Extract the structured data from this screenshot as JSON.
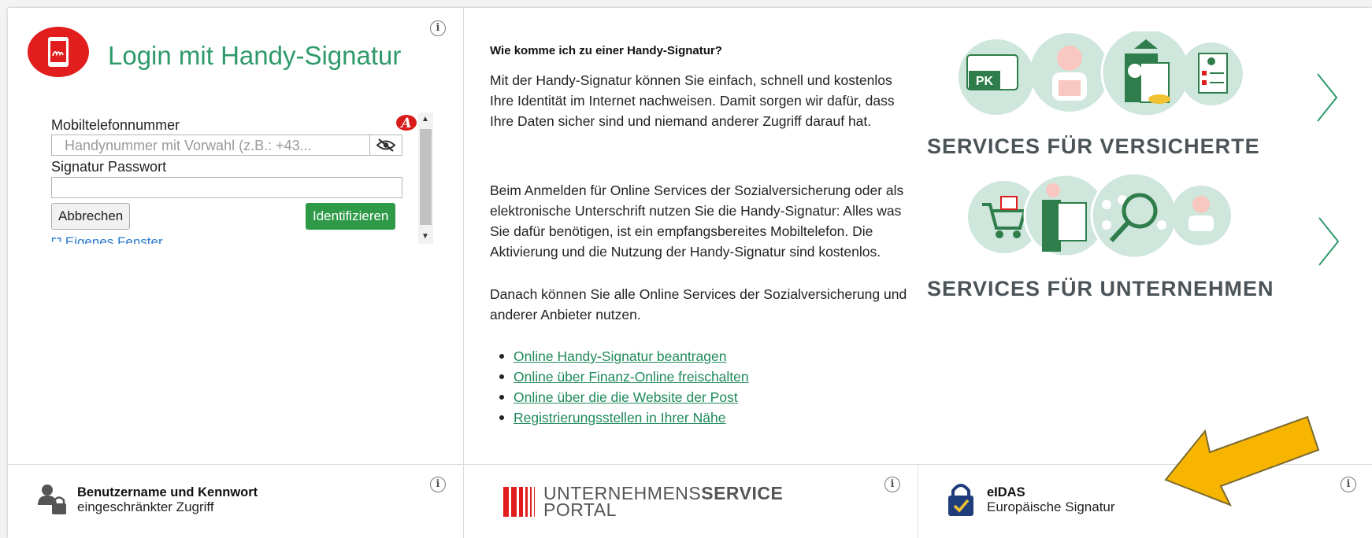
{
  "login": {
    "title": "Login mit Handy-Signatur",
    "phone_label": "Mobiltelefonnummer",
    "phone_placeholder": "Handynummer mit Vorwahl (z.B.: +43...",
    "password_label": "Signatur Passwort",
    "cancel_label": "Abbrechen",
    "identify_label": "Identifizieren",
    "own_window_label": "Eigenes Fenster"
  },
  "info": {
    "heading": "Wie komme ich zu einer Handy-Signatur?",
    "paragraph1": "Mit der Handy-Signatur können Sie einfach, schnell und kostenlos Ihre Identität im Internet nachweisen. Damit sorgen wir dafür, dass Ihre Daten sicher sind und niemand anderer Zugriff darauf hat.",
    "paragraph2": "Beim Anmelden für Online Services der Sozialversicherung oder als elektronische Unterschrift nutzen Sie die Handy-Signatur: Alles was Sie dafür benötigen, ist ein empfangsbereites Mobiltelefon. Die Aktivierung und die Nutzung der Handy-Signatur sind kostenlos.",
    "paragraph3": "Danach können Sie alle Online Services der Sozialversicherung und anderer Anbieter nutzen.",
    "links": [
      "Online Handy-Signatur beantragen",
      "Online über Finanz-Online freischalten",
      "Online über die die Website der Post",
      "Registrierungsstellen in Ihrer Nähe"
    ]
  },
  "services": {
    "insured_title": "SERVICES FÜR VERSICHERTE",
    "insured_icon_text": "PK",
    "business_title": "SERVICES FÜR UNTERNEHMEN"
  },
  "bottom": {
    "userpass_title": "Benutzername und Kennwort",
    "userpass_sub": "eingeschränkter Zugriff",
    "usp_line1_thin": "UNTERNEHMENS",
    "usp_line1_bold": "SERVICE",
    "usp_line2": "PORTAL",
    "eidas_title": "eIDAS",
    "eidas_sub": "Europäische Signatur"
  },
  "colors": {
    "brand_green": "#2e9a6a",
    "button_green": "#2e9a47",
    "logo_red": "#e11d1d",
    "annotation_arrow": "#f7b500",
    "icon_circle": "#cfe6dc"
  },
  "icons": [
    "info-icon",
    "handy-signatur-logo",
    "eye-slash-icon",
    "a-trust-icon",
    "chevron-right-icon",
    "user-lock-icon",
    "eidas-lock-icon",
    "annotation-arrow"
  ]
}
